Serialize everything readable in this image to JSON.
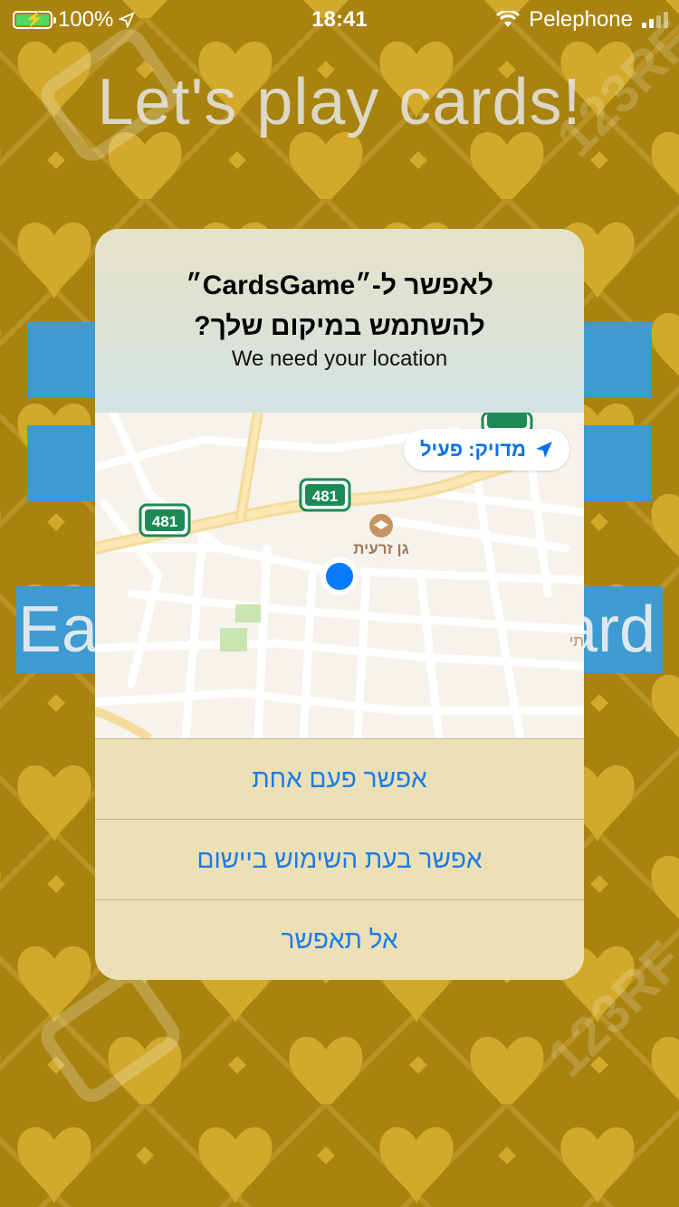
{
  "status_bar": {
    "battery": "100%",
    "time": "18:41",
    "carrier": "Pelephone"
  },
  "background": {
    "title": "Let's play cards!",
    "partial_button_left": "Ea",
    "partial_button_right": "ard",
    "watermark": "123RF"
  },
  "alert": {
    "title_line1": "לאפשר ל-״CardsGame״",
    "title_line2": "להשתמש במיקום שלך?",
    "message": "We need your location",
    "map": {
      "precise_label": "מדויק: פעיל",
      "road_number": "481",
      "place_label": "גן זרעית",
      "edge_label": "תי"
    },
    "buttons": {
      "allow_once": "אפשר פעם אחת",
      "allow_while_using": "אפשר בעת השימוש ביישום",
      "dont_allow": "אל תאפשר"
    }
  },
  "colors": {
    "background_gold": "#a9830f",
    "heart_gold": "#d4aa2b",
    "button_blue": "#3d9bd1",
    "alert_action_blue": "#1a7ce6",
    "location_dot": "#0a7aff"
  }
}
